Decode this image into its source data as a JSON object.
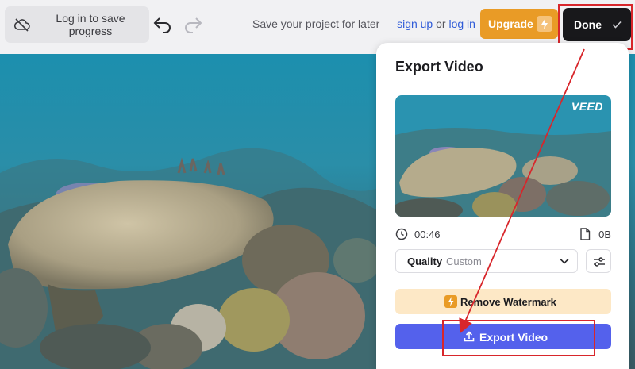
{
  "topbar": {
    "login_label": "Log in to save progress",
    "save_message_prefix": "Save your project for later — ",
    "sign_up_link": "sign up",
    "or_text": " or ",
    "log_in_link": "log in",
    "upgrade_label": "Upgrade",
    "done_label": "Done"
  },
  "export_panel": {
    "title": "Export Video",
    "thumbnail_logo": "VEED",
    "duration": "00:46",
    "file_size": "0B",
    "quality_label": "Quality",
    "quality_value": "Custom",
    "remove_watermark_label": "Remove Watermark",
    "export_label": "Export Video"
  },
  "icons": {
    "cloud": "cloud-off-icon",
    "undo": "undo-icon",
    "redo": "redo-icon",
    "bolt": "bolt-icon",
    "check": "check-icon",
    "clock": "clock-icon",
    "file": "file-icon",
    "chevron": "chevron-down-icon",
    "settings": "sliders-icon",
    "upload": "upload-icon"
  },
  "colors": {
    "upgrade": "#e99b26",
    "done": "#18181b",
    "export": "#5461ec",
    "watermark_bg": "#fde8c6",
    "highlight": "#d8262b",
    "link": "#2f5bd8"
  }
}
